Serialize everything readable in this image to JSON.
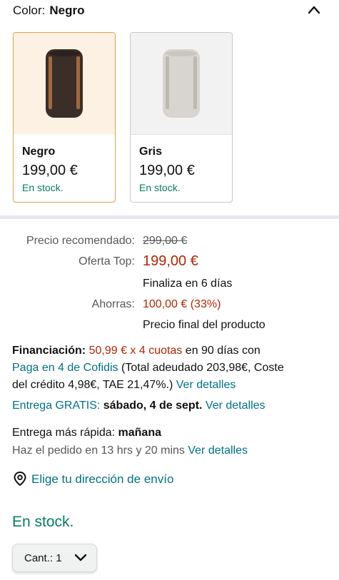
{
  "color": {
    "label": "Color:",
    "value": "Negro"
  },
  "swatches": [
    {
      "name": "Negro",
      "price": "199,00 €",
      "stock": "En stock.",
      "speaker_color": "#3a2f28",
      "accent": "#a3683b"
    },
    {
      "name": "Gris",
      "price": "199,00 €",
      "stock": "En stock.",
      "speaker_color": "#d8d4cf",
      "accent": "#c9c5c0"
    }
  ],
  "pricing": {
    "recommended_label": "Precio recomendado:",
    "recommended_value": "299,00 €",
    "offer_label": "Oferta Top:",
    "offer_value": "199,00 €",
    "offer_ends": "Finaliza en 6 días",
    "savings_label": "Ahorras:",
    "savings_value": "100,00 € (33%)",
    "final_note": "Precio final del producto"
  },
  "financing": {
    "label": "Financiación:",
    "installments": "50,99 € x 4 cuotas",
    "term": " en 90 días con",
    "provider": "Paga en 4 de Cofidis",
    "details_1": " (Total adeudado 203,98€, Coste",
    "details_2": "del crédito 4,98€, TAE 21,47%.) ",
    "details_link": "Ver detalles"
  },
  "delivery": {
    "free_label": "Entrega GRATIS:",
    "free_date": " sábado, 4 de sept.",
    "free_link": " Ver detalles",
    "fast_label": "Entrega más rápida: ",
    "fast_date": "mañana",
    "order_within": "Haz el pedido en 13 hrs y 20 mins ",
    "order_link": "Ver detalles"
  },
  "address_link": "Elige tu dirección de envío",
  "availability": "En stock.",
  "quantity": {
    "label": "Cant.:",
    "value": "1"
  },
  "colors": {
    "price_red": "#b12704",
    "link_teal": "#007185",
    "stock_green": "#067d62",
    "selected_border": "#d9a64a"
  }
}
